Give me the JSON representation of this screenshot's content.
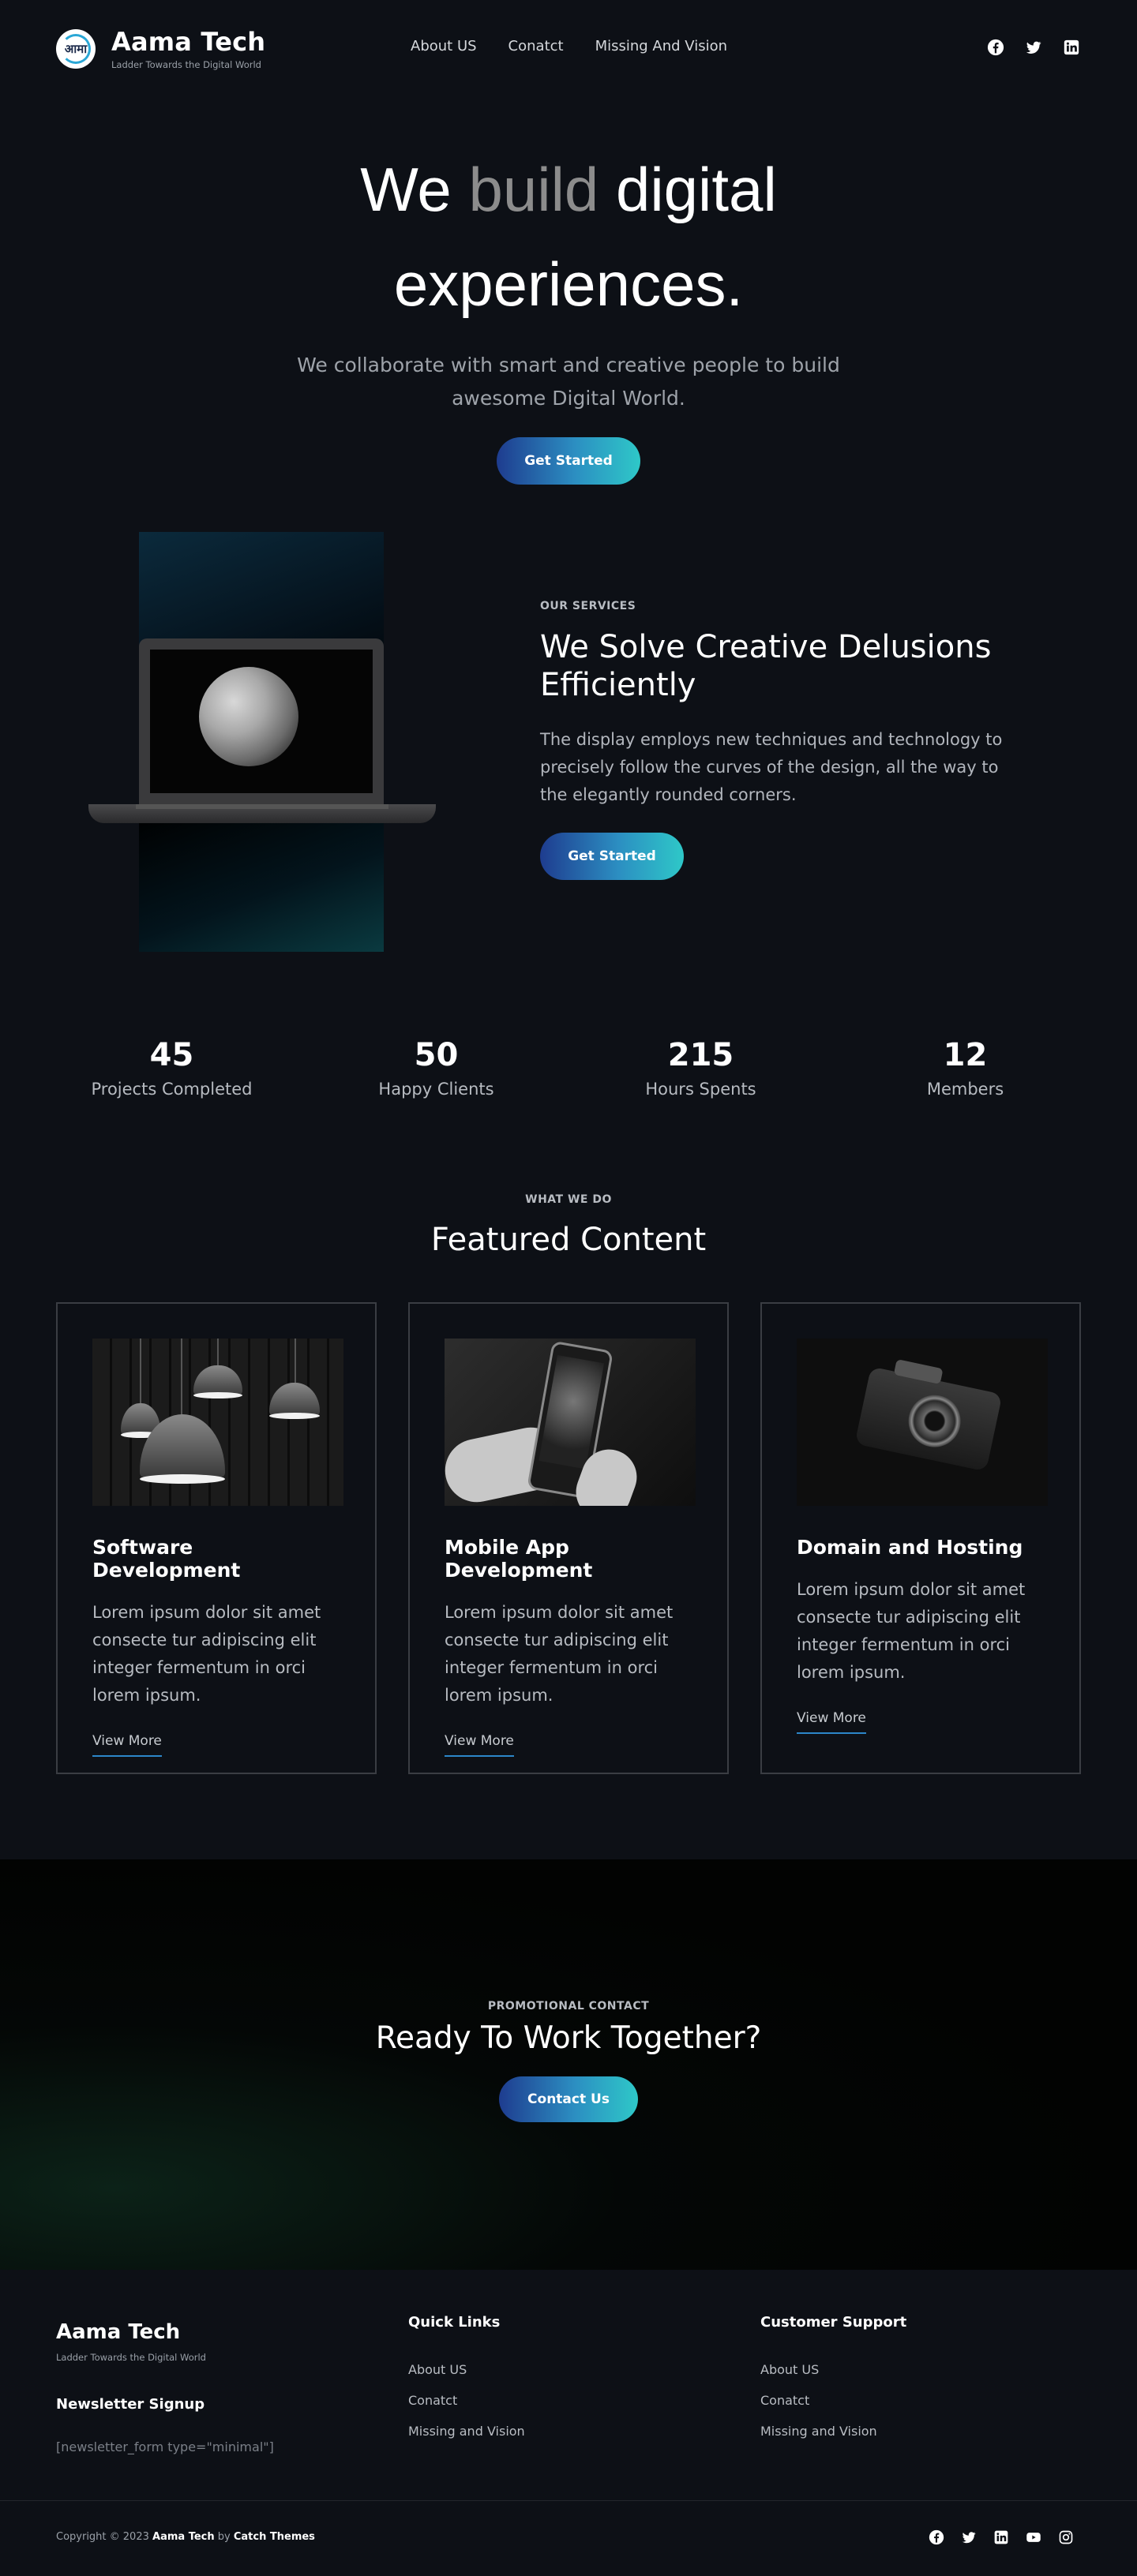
{
  "header": {
    "brand_name": "Aama Tech",
    "tagline": "Ladder Towards the Digital World",
    "logo_glyph": "आमा",
    "nav": [
      "About US",
      "Conatct",
      "Missing And Vision"
    ],
    "social_icons": [
      "facebook-icon",
      "twitter-icon",
      "linkedin-icon"
    ]
  },
  "hero": {
    "title_word1": "We",
    "title_word2": "build",
    "title_word3": "digital",
    "title_line2": "experiences.",
    "subtitle": "We collaborate with smart and creative people to build awesome Digital World.",
    "cta": "Get Started"
  },
  "services": {
    "eyebrow": "OUR SERVICES",
    "title": "We Solve Creative Delusions Efficiently",
    "body": "The display employs new techniques and technology to precisely follow the curves of the design, all the way to the elegantly rounded corners.",
    "cta": "Get Started"
  },
  "stats": [
    {
      "value": "45",
      "label": "Projects Completed"
    },
    {
      "value": "50",
      "label": "Happy Clients"
    },
    {
      "value": "215",
      "label": "Hours Spents"
    },
    {
      "value": "12",
      "label": "Members"
    }
  ],
  "featured": {
    "eyebrow": "WHAT WE DO",
    "title": "Featured Content",
    "cards": [
      {
        "title": "Software Development",
        "body": "Lorem ipsum dolor sit amet consecte tur adipiscing elit integer fermentum in orci lorem ipsum.",
        "link": "View More"
      },
      {
        "title": "Mobile App Development",
        "body": "Lorem ipsum dolor sit amet consecte tur adipiscing elit integer fermentum in orci lorem ipsum.",
        "link": "View More"
      },
      {
        "title": "Domain and Hosting",
        "body": "Lorem ipsum dolor sit amet consecte tur adipiscing elit integer fermentum in orci lorem ipsum.",
        "link": "View More"
      }
    ]
  },
  "promo": {
    "eyebrow": "PROMOTIONAL CONTACT",
    "title": "Ready To Work Together?",
    "cta": "Contact Us"
  },
  "footer": {
    "brand_name": "Aama Tech",
    "tagline": "Ladder Towards the Digital World",
    "newsletter_title": "Newsletter Signup",
    "newsletter_shortcode": "[newsletter_form type=\"minimal\"]",
    "quick_links_title": "Quick Links",
    "quick_links": [
      "About US",
      "Conatct",
      "Missing and Vision"
    ],
    "support_title": "Customer Support",
    "support_links": [
      "About US",
      "Conatct",
      "Missing and Vision"
    ],
    "copyright_prefix": "Copyright © 2023",
    "copyright_brand": "Aama Tech",
    "copyright_by": "by",
    "copyright_author": "Catch Themes",
    "social_icons": [
      "facebook-icon",
      "twitter-icon",
      "linkedin-icon",
      "youtube-icon",
      "instagram-icon"
    ]
  },
  "colors": {
    "background": "#0d1016",
    "accent_start": "#1e3c8f",
    "accent_end": "#2ec8c8"
  }
}
